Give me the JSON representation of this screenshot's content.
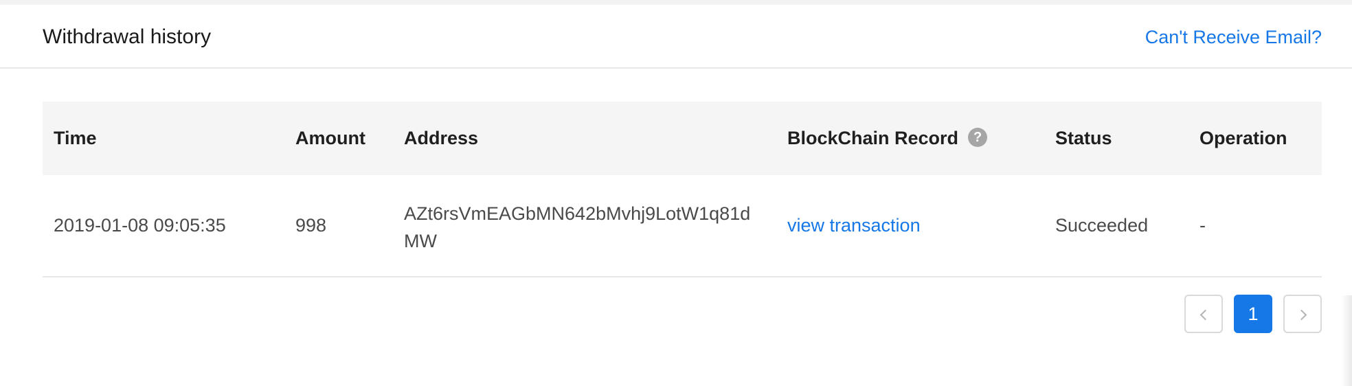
{
  "header": {
    "title": "Withdrawal history",
    "help_link": "Can't Receive Email?"
  },
  "table": {
    "columns": {
      "time": "Time",
      "amount": "Amount",
      "address": "Address",
      "blockchain_record": "BlockChain Record",
      "status": "Status",
      "operation": "Operation"
    },
    "help_icon_text": "?",
    "rows": [
      {
        "time": "2019-01-08 09:05:35",
        "amount": "998",
        "address": "AZt6rsVmEAGbMN642bMvhj9LotW1q81dMW",
        "blockchain_record": "view transaction",
        "status": "Succeeded",
        "operation": "-"
      }
    ]
  },
  "pagination": {
    "current_page": "1",
    "prev_icon": "chevron-left-icon",
    "next_icon": "chevron-right-icon"
  },
  "colors": {
    "accent": "#1677e6",
    "header_bg": "#f5f5f5",
    "border": "#e8e8e8"
  }
}
